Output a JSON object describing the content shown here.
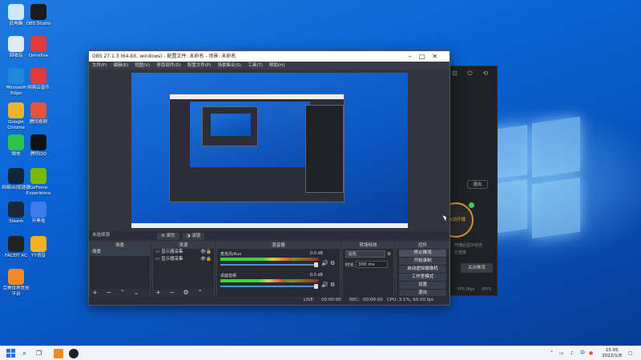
{
  "desktop": {
    "icons": [
      {
        "label": "此电脑",
        "color": "#cfe8ff",
        "icon": "computer-icon"
      },
      {
        "label": "OBS Studio",
        "color": "#1b1b1b",
        "icon": "obs-icon"
      },
      {
        "label": "回收站",
        "color": "#dbe9f8",
        "icon": "recycle-bin-icon"
      },
      {
        "label": "Omnilive",
        "color": "#e23b3b",
        "icon": "omnilive-icon"
      },
      {
        "label": "Microsoft Edge",
        "color": "#1e88d9",
        "icon": "edge-icon"
      },
      {
        "label": "网易云音乐",
        "color": "#e03a3a",
        "icon": "netease-music-icon"
      },
      {
        "label": "Google Chrome",
        "color": "#e9b42c",
        "icon": "chrome-icon"
      },
      {
        "label": "腾讯视频",
        "color": "#e8503a",
        "icon": "tencent-video-icon"
      },
      {
        "label": "微信",
        "color": "#2dc24a",
        "icon": "wechat-icon"
      },
      {
        "label": "腾讯QQ",
        "color": "#111111",
        "icon": "qq-icon"
      },
      {
        "label": "网易UU加速器",
        "color": "#10263b",
        "icon": "uu-booster-icon"
      },
      {
        "label": "GeForce Experience",
        "color": "#76b900",
        "icon": "geforce-icon"
      },
      {
        "label": "Steam",
        "color": "#1b2838",
        "icon": "steam-icon"
      },
      {
        "label": "开黑啦",
        "color": "#3a7bf0",
        "icon": "kaiheila-icon"
      },
      {
        "label": "FACEIT AC",
        "color": "#222222",
        "icon": "faceit-icon"
      },
      {
        "label": "YY语音",
        "color": "#f5b21e",
        "icon": "yy-icon"
      },
      {
        "label": "完美世界竞技平台",
        "color": "#f08a24",
        "icon": "perfect-world-icon"
      }
    ]
  },
  "back_app": {
    "exit_label": "退出",
    "status": "启动开播",
    "line1": "开播后显示状态",
    "line2": "已连接",
    "stop_label": "关闭推流",
    "footer_left": "FPS 0fps",
    "footer_right": "0FPS"
  },
  "obs": {
    "title": "OBS 27.1.3 (64-bit, windows) - 配置文件: 未命名 - 场景: 未命名",
    "menu": [
      "文件(F)",
      "编辑(E)",
      "视图(V)",
      "停靠部件(D)",
      "配置文件(P)",
      "场景集合(S)",
      "工具(T)",
      "帮助(H)"
    ],
    "scene_label": "未选择源",
    "tab_properties": "属性",
    "tab_filters": "滤镜",
    "docks": {
      "scenes": {
        "title": "场景",
        "items": [
          "场景"
        ]
      },
      "sources": {
        "title": "来源",
        "items": [
          "显示器采集",
          "显示器采集"
        ]
      },
      "mixer": {
        "title": "混音器",
        "tracks": [
          {
            "name": "麦克风/Aux",
            "db": "0.0 dB",
            "level": 0.72
          },
          {
            "name": "桌面音频",
            "db": "0.0 dB",
            "level": 0.65
          }
        ]
      },
      "transitions": {
        "title": "转场特效",
        "type": "淡化",
        "duration_label": "时长",
        "duration": "300 ms"
      },
      "controls": {
        "title": "控件",
        "buttons": [
          "停止推流",
          "开始录制",
          "启动虚拟摄像机",
          "工作室模式",
          "设置",
          "退出"
        ]
      }
    },
    "status": {
      "live_label": "LIVE:",
      "live_time": "00:00:00",
      "rec_label": "REC:",
      "rec_time": "00:00:00",
      "cpu": "CPU: 3.1%, 60.00 fps"
    }
  },
  "taskbar": {
    "tray_text": "中",
    "time": "15:05",
    "date": "2022/1/8"
  }
}
